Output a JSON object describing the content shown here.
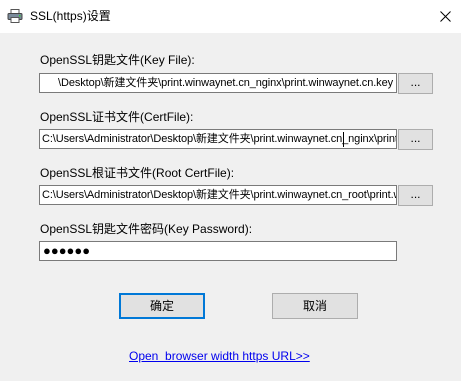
{
  "window": {
    "title": "SSL(https)设置",
    "icon": "printer-icon",
    "close_icon": "close-icon"
  },
  "fields": {
    "key_file": {
      "label": "OpenSSL钥匙文件(Key File):",
      "value": "\\Desktop\\新建文件夹\\print.winwaynet.cn_nginx\\print.winwaynet.cn.key",
      "browse_label": "..."
    },
    "cert_file": {
      "label": "OpenSSL证书文件(CertFile):",
      "value": "C:\\Users\\Administrator\\Desktop\\新建文件夹\\print.winwaynet.cn_nginx\\print.winwaynet.cn.crt",
      "browse_label": "..."
    },
    "root_cert_file": {
      "label": "OpenSSL根证书文件(Root CertFile):",
      "value": "C:\\Users\\Administrator\\Desktop\\新建文件夹\\print.winwaynet.cn_root\\print.winwaynet.cn_root.crt",
      "browse_label": "..."
    },
    "key_password": {
      "label": "OpenSSL钥匙文件密码(Key Password):",
      "value": "●●●●●●"
    }
  },
  "buttons": {
    "ok_label": "确定",
    "cancel_label": "取消"
  },
  "link": {
    "text": "Open  browser width https URL>>"
  }
}
